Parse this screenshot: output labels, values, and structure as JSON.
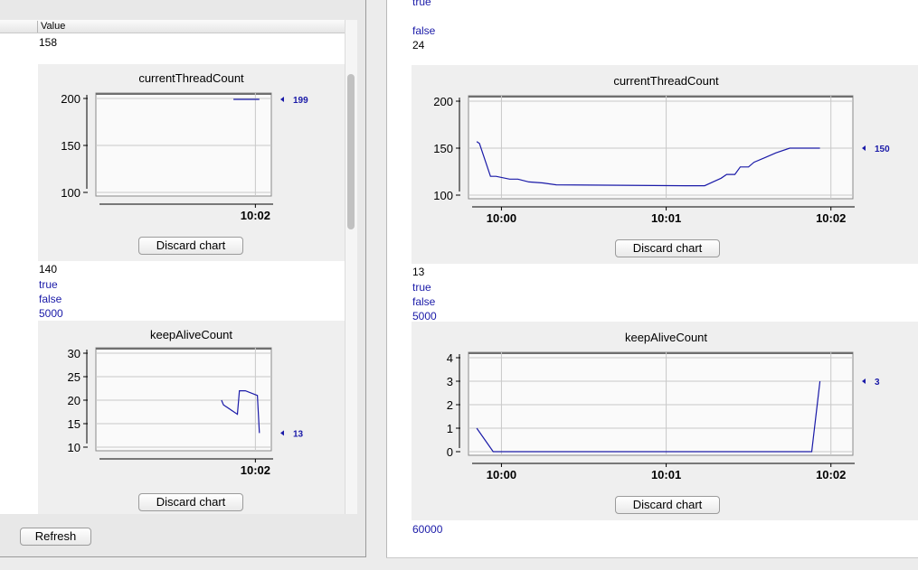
{
  "left": {
    "column_header": "Value",
    "values_top": [
      "158"
    ],
    "chart1": {
      "title": "currentThreadCount",
      "y_ticks": [
        "200",
        "150",
        "100"
      ],
      "x_ticks": [
        "10:02"
      ],
      "last_value_label": "199",
      "discard_label": "Discard chart"
    },
    "values_mid": [
      "140",
      "true",
      "false",
      "5000"
    ],
    "chart2": {
      "title": "keepAliveCount",
      "y_ticks": [
        "30",
        "25",
        "20",
        "15",
        "10"
      ],
      "x_ticks": [
        "10:02"
      ],
      "last_value_label": "13",
      "discard_label": "Discard chart"
    },
    "refresh_label": "Refresh"
  },
  "right": {
    "values_top": [
      "true",
      "false",
      "24"
    ],
    "chart1": {
      "title": "currentThreadCount",
      "y_ticks": [
        "200",
        "150",
        "100"
      ],
      "x_ticks": [
        "10:00",
        "10:01",
        "10:02"
      ],
      "last_value_label": "150",
      "discard_label": "Discard chart"
    },
    "values_mid": [
      "13",
      "true",
      "false",
      "5000"
    ],
    "chart2": {
      "title": "keepAliveCount",
      "y_ticks": [
        "4",
        "3",
        "2",
        "1",
        "0"
      ],
      "x_ticks": [
        "10:00",
        "10:01",
        "10:02"
      ],
      "last_value_label": "3",
      "discard_label": "Discard chart"
    },
    "values_bottom": [
      "60000"
    ]
  },
  "colors": {
    "series": "#1a1aa8",
    "panel": "#efefef",
    "grid": "#c8c8c8"
  },
  "chart_data": [
    {
      "type": "line",
      "title": "currentThreadCount",
      "ylim": [
        100,
        200
      ],
      "x": [
        "10:01:49",
        "10:02:02"
      ],
      "series": [
        {
          "values": [
            199,
            199
          ]
        }
      ]
    },
    {
      "type": "line",
      "title": "keepAliveCount",
      "ylim": [
        10,
        30
      ],
      "x": [
        "10:01:43",
        "10:01:44",
        "10:01:51",
        "10:01:52",
        "10:01:55",
        "10:02:01",
        "10:02:02"
      ],
      "series": [
        {
          "values": [
            20,
            19,
            17,
            22,
            22,
            21,
            13
          ]
        }
      ]
    },
    {
      "type": "line",
      "title": "currentThreadCount",
      "ylim": [
        100,
        200
      ],
      "x": [
        "09:59:51",
        "09:59:52",
        "09:59:56",
        "09:59:58",
        "10:00:03",
        "10:00:06",
        "10:00:10",
        "10:00:15",
        "10:00:20",
        "10:01:07",
        "10:01:09",
        "10:01:10",
        "10:01:14",
        "10:01:17",
        "10:01:20",
        "10:01:22",
        "10:01:25",
        "10:01:27",
        "10:01:30",
        "10:01:32",
        "10:01:36",
        "10:01:40",
        "10:01:45",
        "10:01:56"
      ],
      "series": [
        {
          "values": [
            157,
            155,
            120,
            120,
            117,
            117,
            114,
            113,
            111,
            110,
            110,
            110,
            110,
            114,
            118,
            122,
            122,
            130,
            130,
            135,
            140,
            145,
            150,
            150
          ]
        }
      ]
    },
    {
      "type": "line",
      "title": "keepAliveCount",
      "ylim": [
        0,
        4
      ],
      "x": [
        "09:59:51",
        "09:59:57",
        "10:01:53",
        "10:01:56"
      ],
      "series": [
        {
          "values": [
            1,
            0,
            0,
            3
          ]
        }
      ]
    }
  ]
}
